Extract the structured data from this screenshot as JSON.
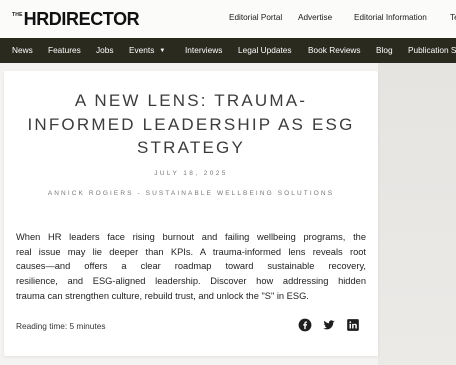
{
  "header": {
    "logo_prefix": "THE",
    "logo_main": "HRDIRECTOR",
    "top_links": [
      "Editorial Portal",
      "Advertise",
      "Editorial Information",
      "Te"
    ]
  },
  "nav": {
    "items": [
      "News",
      "Features",
      "Jobs",
      "Events",
      "Interviews",
      "Legal Updates",
      "Book Reviews",
      "Blog",
      "Publication S"
    ]
  },
  "article": {
    "title_lines": [
      "A NEW LENS: TRAUMA-",
      "INFORMED LEADERSHIP AS ESG",
      "STRATEGY"
    ],
    "date": "JULY 18, 2025",
    "byline": "ANNICK ROGIERS - SUSTAINABLE WELLBEING SOLUTIONS",
    "summary_lines": [
      "When HR leaders face rising burnout and failing wellbeing programs, the",
      "real issue may lie deeper than KPIs. A trauma-informed lens reveals root",
      "causes—and offers a clear roadmap toward sustainable recovery,",
      "resilience, and ESG-aligned leadership. Discover how addressing hidden",
      "trauma can strengthen culture, rebuild trust, and unlock the \"S\" in ESG."
    ],
    "reading_time": "Reading time: 5 minutes"
  },
  "share": {
    "icons": [
      "facebook-icon",
      "twitter-icon",
      "linkedin-icon"
    ]
  },
  "colors": {
    "nav_bg": "#2a2a1f",
    "title_color": "#3c3c3c",
    "page_bg": "#f4f3f1"
  }
}
